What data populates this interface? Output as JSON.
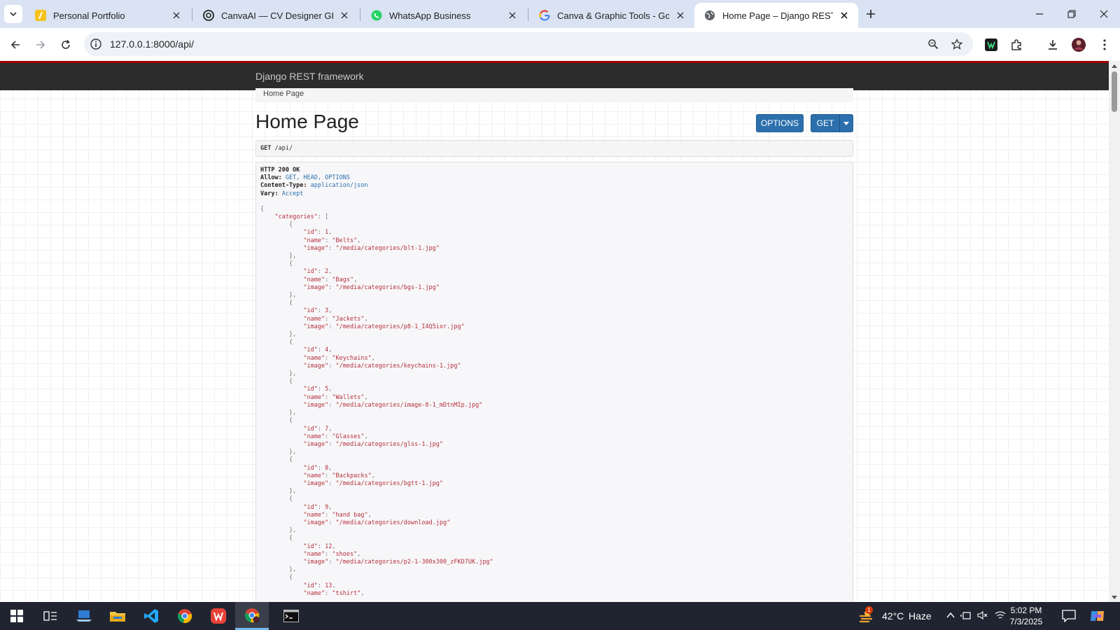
{
  "browser": {
    "tabs": [
      {
        "title": "Personal Portfolio",
        "active": false
      },
      {
        "title": "CanvaAI — CV Designer GPT - C",
        "active": false
      },
      {
        "title": "WhatsApp Business",
        "active": false
      },
      {
        "title": "Canva & Graphic Tools - Google",
        "active": false
      },
      {
        "title": "Home Page – Django REST fram",
        "active": true
      }
    ],
    "url": "127.0.0.1:8000/api/"
  },
  "page": {
    "brand": "Django REST framework",
    "breadcrumb": "Home Page",
    "title": "Home Page",
    "options_label": "OPTIONS",
    "get_label": "GET",
    "request_method": "GET",
    "request_path": "/api/",
    "response": {
      "status": "HTTP 200 OK",
      "headers": [
        {
          "name": "Allow:",
          "value": "GET, HEAD, OPTIONS"
        },
        {
          "name": "Content-Type:",
          "value": "application/json"
        },
        {
          "name": "Vary:",
          "value": "Accept"
        }
      ],
      "categories": [
        {
          "id": "1",
          "name": "\"Belts\"",
          "image": "\"/media/categories/blt-1.jpg\""
        },
        {
          "id": "2",
          "name": "\"Bags\"",
          "image": "\"/media/categories/bgs-1.jpg\""
        },
        {
          "id": "3",
          "name": "\"Jackets\"",
          "image": "\"/media/categories/p8-1_I4Q5ixr.jpg\""
        },
        {
          "id": "4",
          "name": "\"Keychains\"",
          "image": "\"/media/categories/keychains-1.jpg\""
        },
        {
          "id": "5",
          "name": "\"Wallets\"",
          "image": "\"/media/categories/image-8-1_mDtnMIp.jpg\""
        },
        {
          "id": "7",
          "name": "\"Glasses\"",
          "image": "\"/media/categories/glss-1.jpg\""
        },
        {
          "id": "8",
          "name": "\"Backpacks\"",
          "image": "\"/media/categories/bgtt-1.jpg\""
        },
        {
          "id": "9",
          "name": "\"hand bag\"",
          "image": "\"/media/categories/download.jpg\""
        },
        {
          "id": "12",
          "name": "\"shoes\"",
          "image": "\"/media/categories/p2-1-300x300_zFKD7UK.jpg\""
        },
        {
          "id": "13",
          "name": "\"tshirt\"",
          "image": ""
        }
      ]
    }
  },
  "taskbar": {
    "weather_temp": "42°C",
    "weather_desc": "Haze",
    "weather_badge": "1",
    "time": "5:02 PM",
    "date": "7/3/2025"
  },
  "colors": {
    "accent": "#2c6fad",
    "json_string": "#b5303b",
    "nav_bg": "#2c2c2c",
    "nav_border": "#a30000"
  }
}
